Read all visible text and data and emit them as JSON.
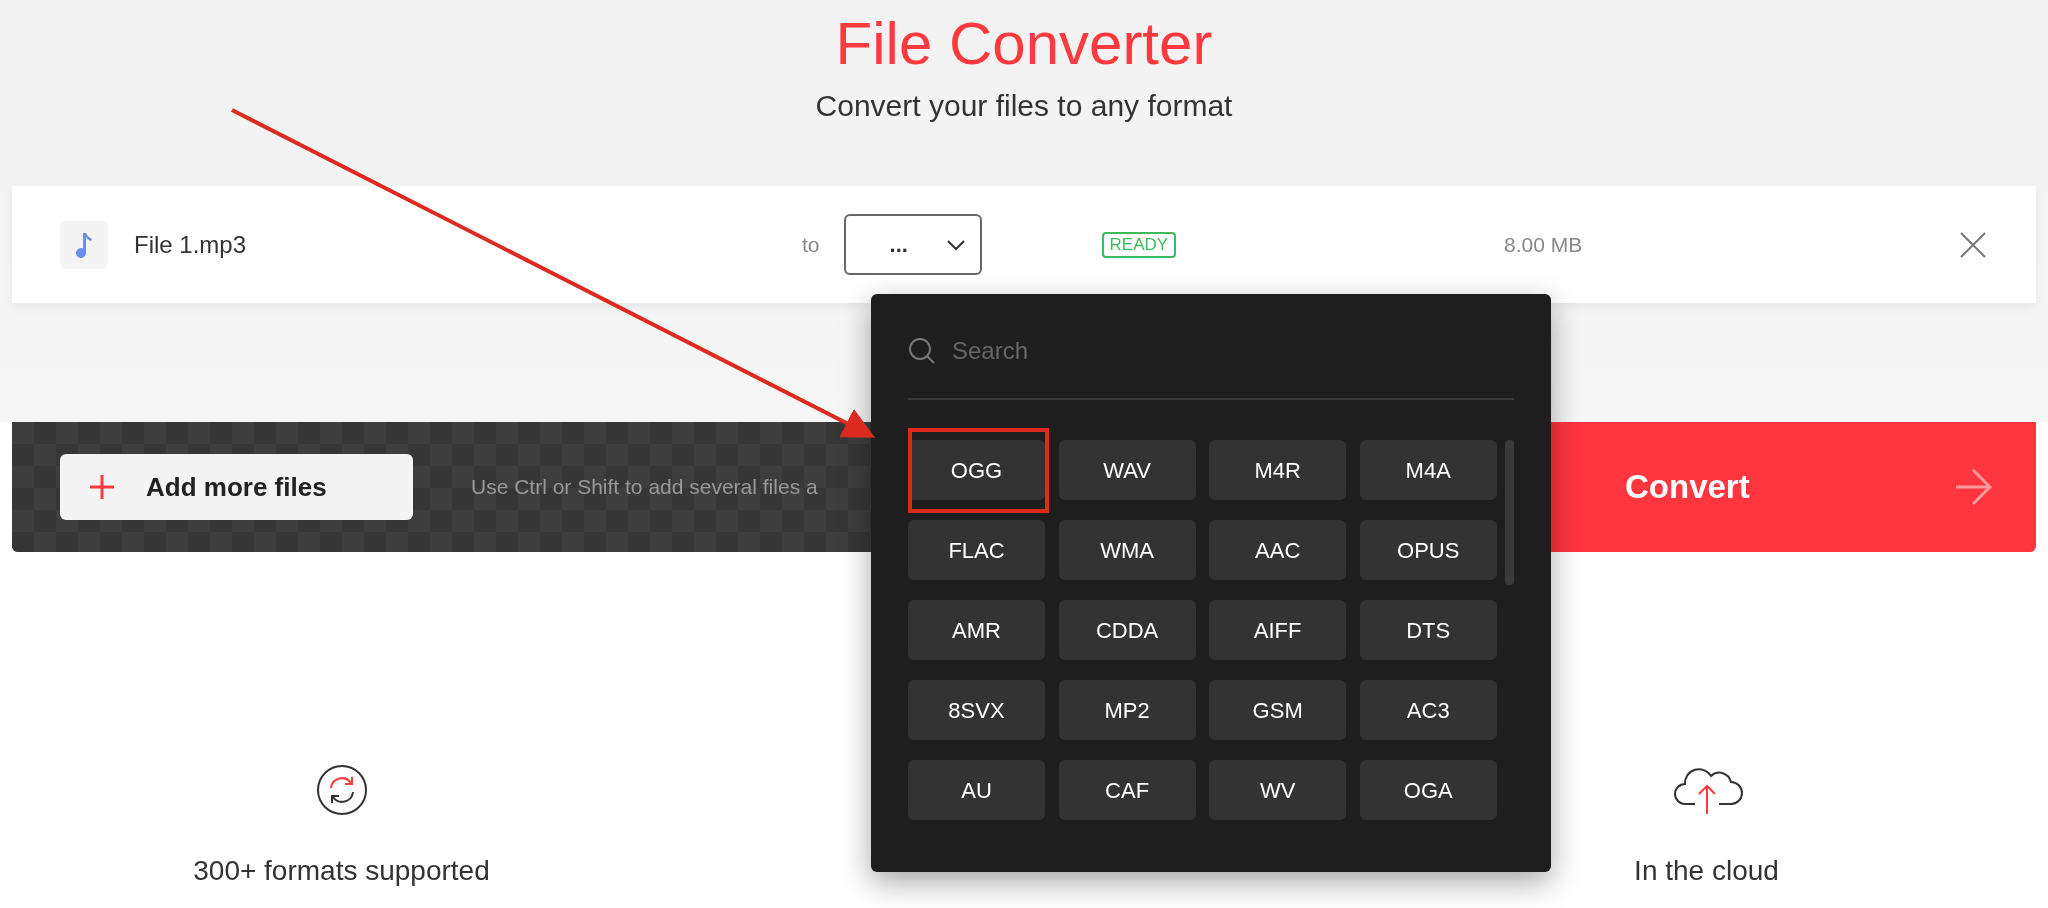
{
  "header": {
    "title": "File Converter",
    "subtitle": "Convert your files to any format"
  },
  "file": {
    "name": "File 1.mp3",
    "to_label": "to",
    "format_value": "...",
    "status": "READY",
    "size": "8.00 MB"
  },
  "toolbar": {
    "add_button": "Add more files",
    "hint": "Use Ctrl or Shift to add several files a",
    "convert_button": "Convert"
  },
  "format_menu": {
    "search_placeholder": "Search",
    "formats": [
      "OGG",
      "WAV",
      "M4R",
      "M4A",
      "FLAC",
      "WMA",
      "AAC",
      "OPUS",
      "AMR",
      "CDDA",
      "AIFF",
      "DTS",
      "8SVX",
      "MP2",
      "GSM",
      "AC3",
      "AU",
      "CAF",
      "WV",
      "OGA"
    ]
  },
  "features": [
    {
      "kind": "formats",
      "label": "300+ formats supported"
    },
    {
      "kind": "cloud",
      "label": "In the cloud"
    }
  ]
}
